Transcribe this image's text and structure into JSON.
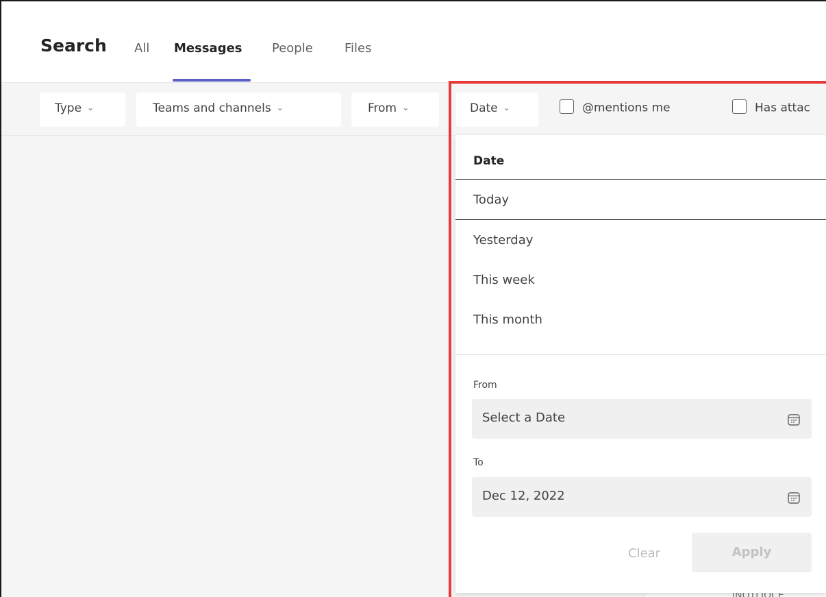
{
  "header": {
    "title": "Search",
    "tabs": [
      {
        "label": "All"
      },
      {
        "label": "Messages",
        "active": true
      },
      {
        "label": "People"
      },
      {
        "label": "Files"
      }
    ]
  },
  "filters": {
    "type": "Type",
    "teams": "Teams and channels",
    "from": "From",
    "date": "Date",
    "mentions": "@mentions me",
    "attachments": "Has attac",
    "chevron": "⌄"
  },
  "dropdown": {
    "header": "Date",
    "options": [
      "Today",
      "Yesterday",
      "This week",
      "This month"
    ],
    "selected": "Today",
    "from_label": "From",
    "from_placeholder": "Select a Date",
    "to_label": "To",
    "to_value": "Dec 12, 2022",
    "clear": "Clear",
    "apply": "Apply"
  },
  "peek_text": "INOTLIOCE",
  "colors": {
    "accent": "#5b5fc7",
    "highlight": "#e8393b",
    "background": "#f5f5f5"
  }
}
